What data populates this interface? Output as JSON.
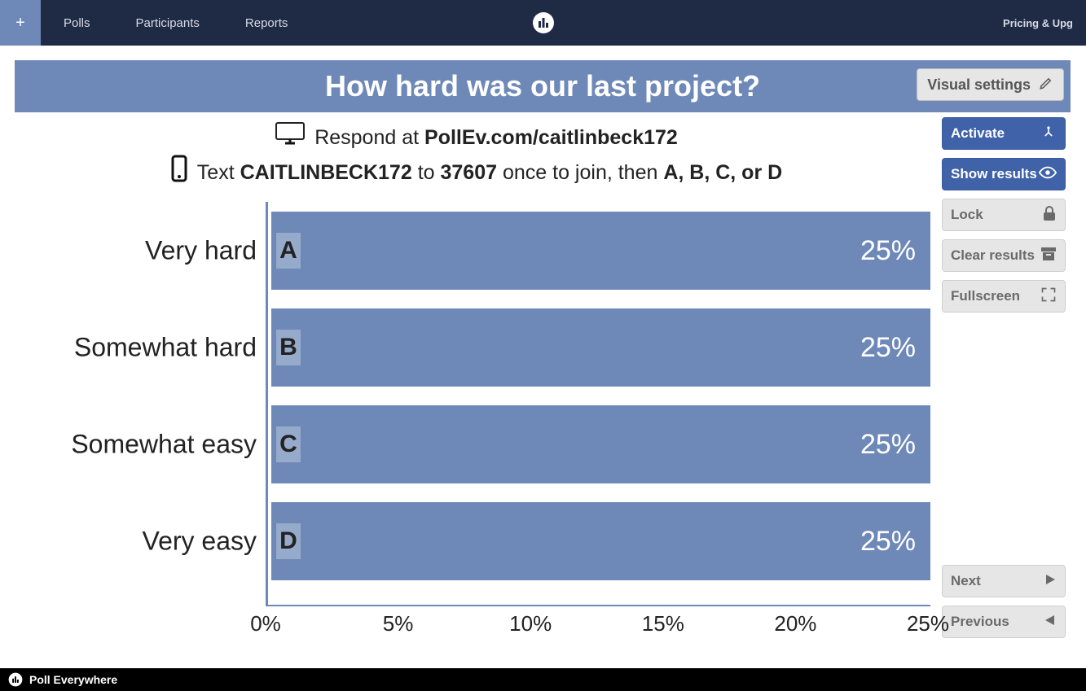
{
  "nav": {
    "add": "+",
    "polls": "Polls",
    "participants": "Participants",
    "reports": "Reports",
    "pricing": "Pricing & Upg"
  },
  "title": "How hard was our last project?",
  "visual_settings": "Visual settings",
  "instructions": {
    "respond_prefix": "Respond at ",
    "respond_url": "PollEv.com/caitlinbeck172",
    "text_prefix": "Text ",
    "code": "CAITLINBECK172",
    "to": " to ",
    "number": "37607",
    "once": " once to join, then ",
    "choices": "A, B, C, or D"
  },
  "side": {
    "activate": "Activate",
    "show": "Show results",
    "lock": "Lock",
    "clear": "Clear results",
    "fullscreen": "Fullscreen",
    "next": "Next",
    "previous": "Previous"
  },
  "footer": {
    "brand": "Poll Everywhere"
  },
  "chart_data": {
    "type": "bar",
    "orientation": "horizontal",
    "title": "How hard was our last project?",
    "xlabel": "",
    "ylabel": "",
    "xlim": [
      0,
      25
    ],
    "categories": [
      "Very hard",
      "Somewhat hard",
      "Somewhat easy",
      "Very easy"
    ],
    "letters": [
      "A",
      "B",
      "C",
      "D"
    ],
    "values": [
      25,
      25,
      25,
      25
    ],
    "value_labels": [
      "25%",
      "25%",
      "25%",
      "25%"
    ],
    "ticks": [
      0,
      5,
      10,
      15,
      20,
      25
    ],
    "tick_labels": [
      "0%",
      "5%",
      "10%",
      "15%",
      "20%",
      "25%"
    ]
  }
}
